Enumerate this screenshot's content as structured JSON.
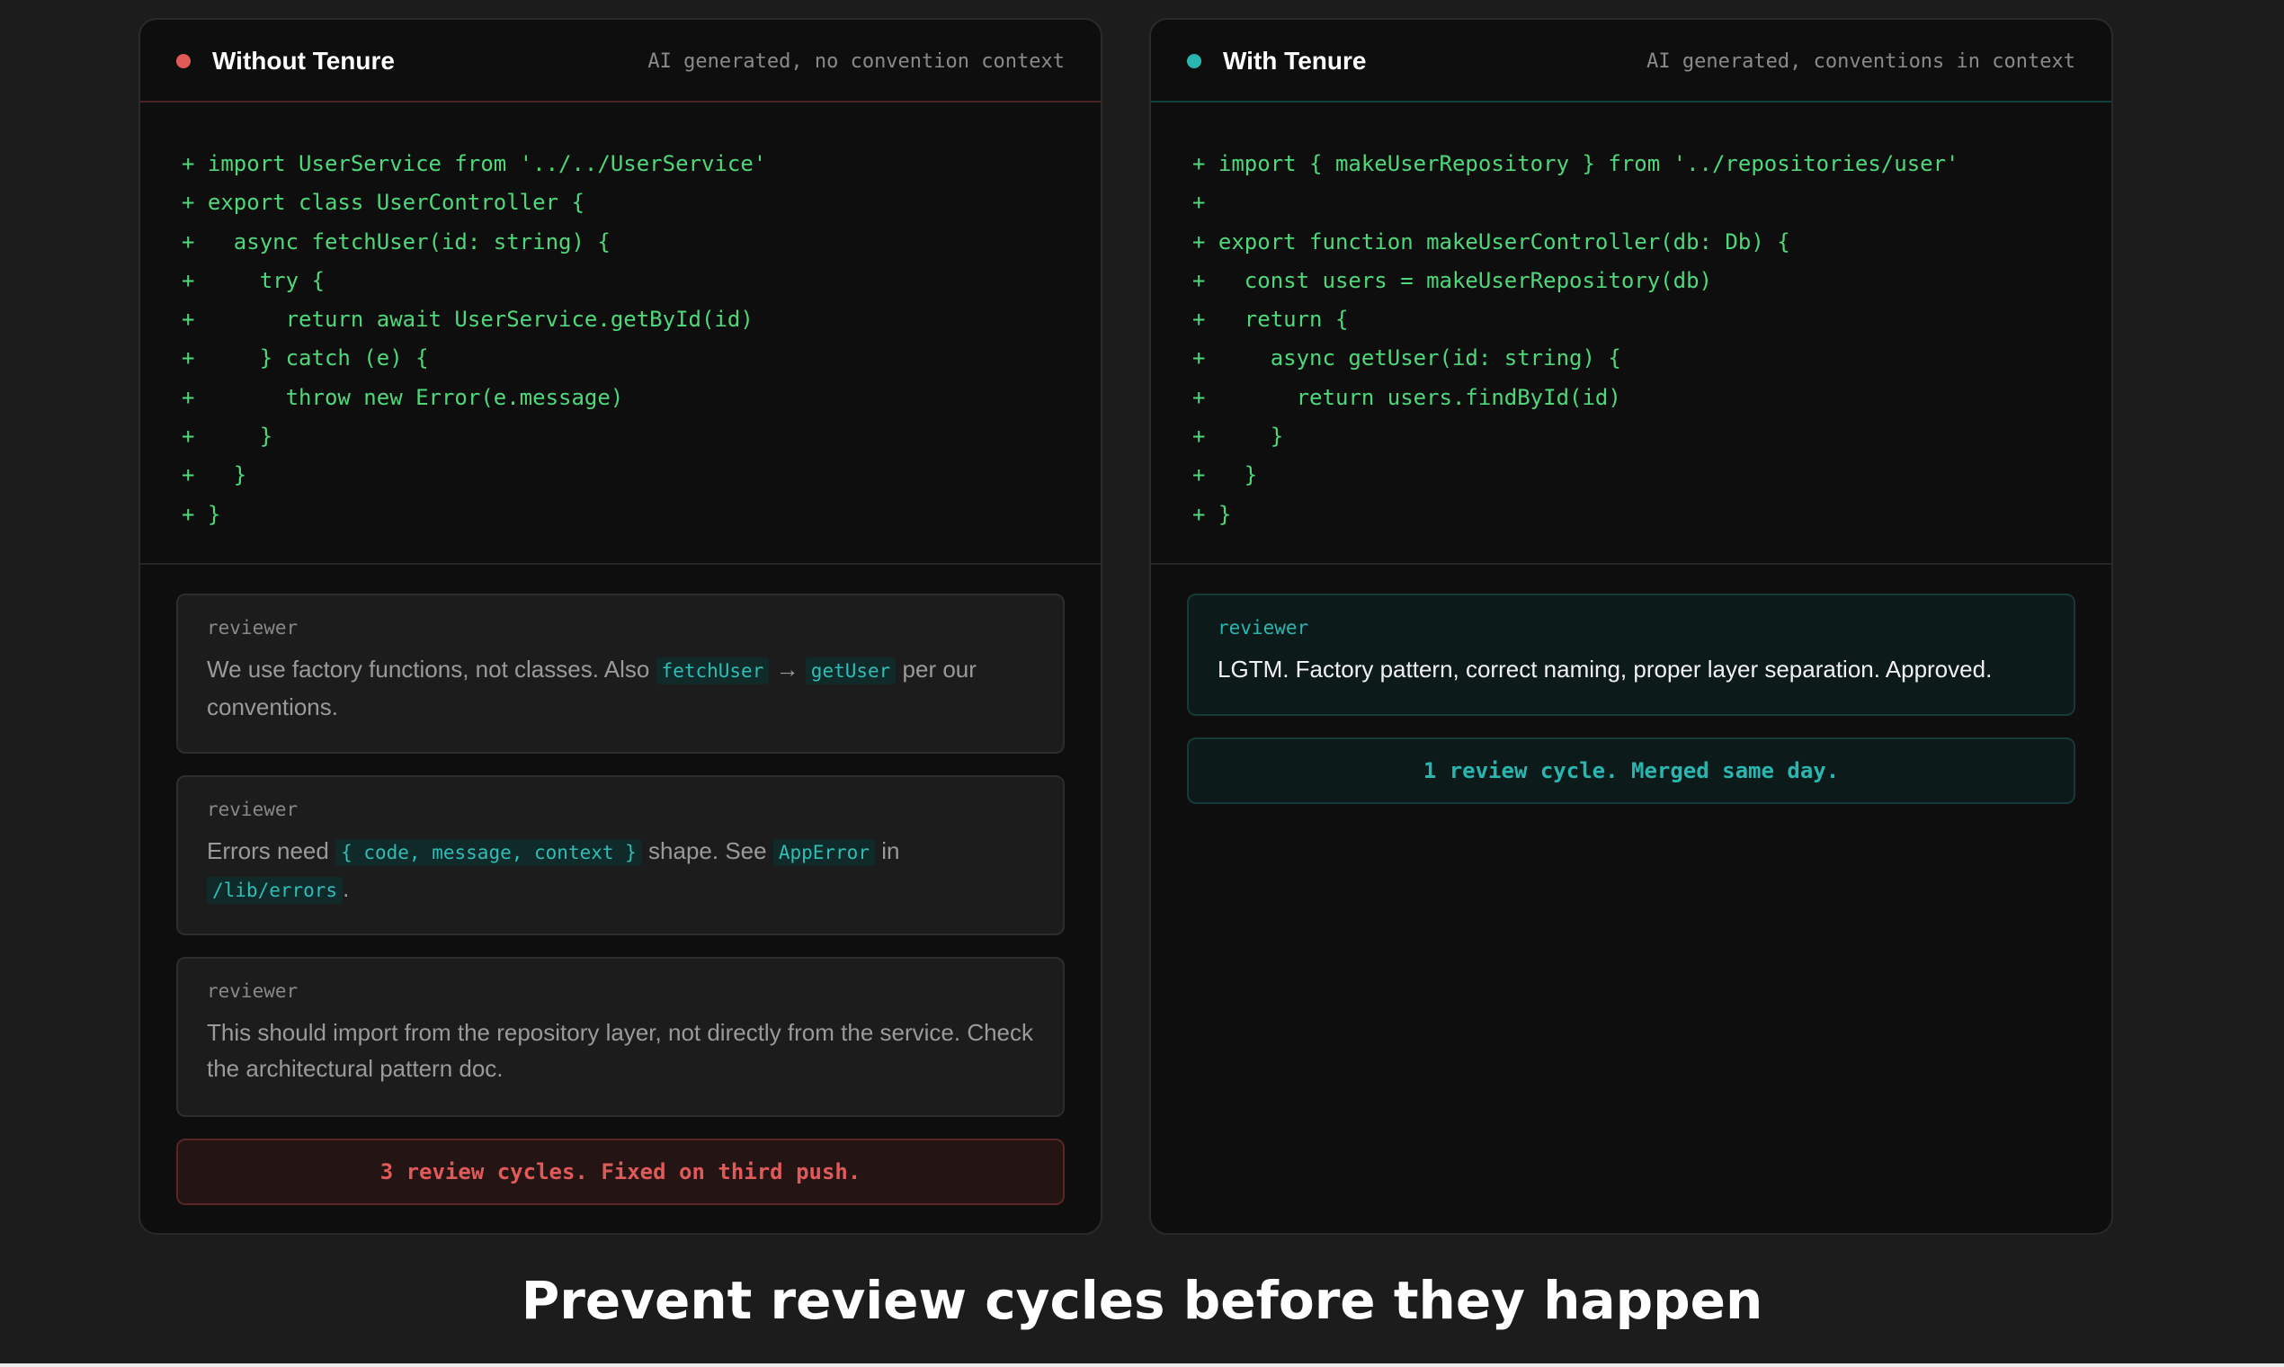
{
  "colors": {
    "accent_bad": "#e05a5a",
    "accent_good": "#29b6b0",
    "code_green": "#4ed87a"
  },
  "left": {
    "title": "Without Tenure",
    "subtitle": "AI generated, no convention context",
    "code": [
      "+ import UserService from '../../UserService'",
      "+ export class UserController {",
      "+   async fetchUser(id: string) {",
      "+     try {",
      "+       return await UserService.getById(id)",
      "+     } catch (e) {",
      "+       throw new Error(e.message)",
      "+     }",
      "+   }",
      "+ }"
    ],
    "comments": [
      {
        "author": "reviewer",
        "parts": [
          {
            "t": "We use factory functions, not classes. Also "
          },
          {
            "t": "fetchUser",
            "code": true
          },
          {
            "t": " → "
          },
          {
            "t": "getUser",
            "code": true
          },
          {
            "t": " per our conventions."
          }
        ]
      },
      {
        "author": "reviewer",
        "parts": [
          {
            "t": "Errors need "
          },
          {
            "t": "{ code, message, context }",
            "code": true
          },
          {
            "t": " shape. See "
          },
          {
            "t": "AppError",
            "code": true
          },
          {
            "t": " in "
          },
          {
            "t": "/lib/errors",
            "code": true
          },
          {
            "t": "."
          }
        ]
      },
      {
        "author": "reviewer",
        "parts": [
          {
            "t": "This should import from the repository layer, not directly from the service. Check the architectural pattern doc."
          }
        ]
      }
    ],
    "summary": "3 review cycles. Fixed on third push."
  },
  "right": {
    "title": "With Tenure",
    "subtitle": "AI generated, conventions in context",
    "code": [
      "+ import { makeUserRepository } from '../repositories/user'",
      "+",
      "+ export function makeUserController(db: Db) {",
      "+   const users = makeUserRepository(db)",
      "+   return {",
      "+     async getUser(id: string) {",
      "+       return users.findById(id)",
      "+     }",
      "+   }",
      "+ }"
    ],
    "comments": [
      {
        "author": "reviewer",
        "parts": [
          {
            "t": "LGTM. Factory pattern, correct naming, proper layer separation. Approved."
          }
        ]
      }
    ],
    "summary": "1 review cycle. Merged same day."
  },
  "headline": "Prevent review cycles before they happen"
}
